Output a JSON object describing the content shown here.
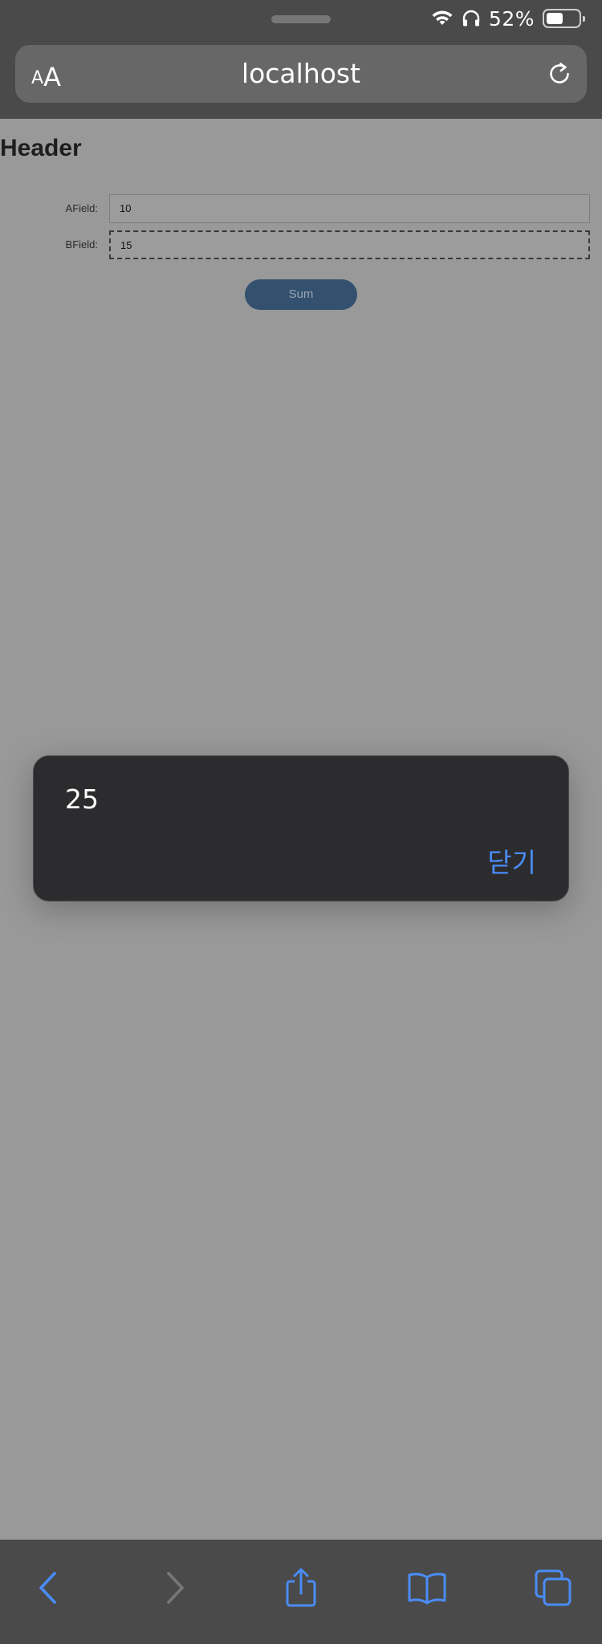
{
  "status_bar": {
    "battery_percent": "52%",
    "battery_level": 0.52,
    "icons": [
      "wifi-icon",
      "headphones-icon",
      "battery-icon"
    ]
  },
  "browser": {
    "text_size_small": "A",
    "text_size_large": "A",
    "url": "localhost"
  },
  "page": {
    "header": "Header",
    "fields": [
      {
        "label": "AField:",
        "value": "10"
      },
      {
        "label": "BField:",
        "value": "15"
      }
    ],
    "sum_button": "Sum"
  },
  "alert": {
    "message": "25",
    "close_label": "닫기"
  },
  "toolbar": {
    "icons": [
      "back-icon",
      "forward-icon",
      "share-icon",
      "bookmarks-icon",
      "tabs-icon"
    ]
  },
  "colors": {
    "accent": "#4a8cf7",
    "page_background": "#999999",
    "chrome_background": "#4a4a4a",
    "alert_background": "#2c2c2e",
    "button_background": "#33506f"
  }
}
